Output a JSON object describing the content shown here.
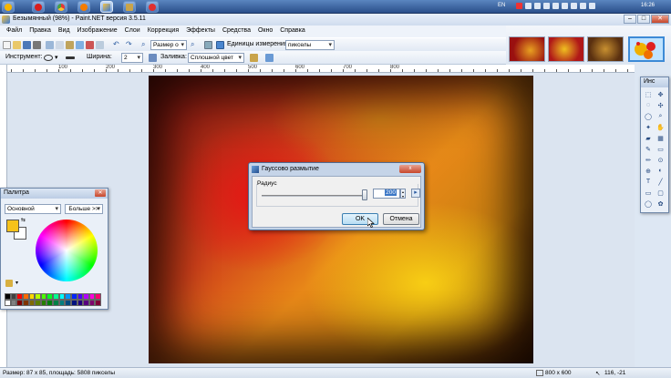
{
  "taskbar": {
    "language": "EN",
    "clock": "16:26"
  },
  "window": {
    "title": "Безымянный (98%) - Paint.NET версия 3.5.11"
  },
  "menu": [
    "Файл",
    "Правка",
    "Вид",
    "Изображение",
    "Слои",
    "Коррекция",
    "Эффекты",
    "Средства",
    "Окно",
    "Справка"
  ],
  "toolbar": {
    "zoom_label": "Размер о",
    "units_label": "Единицы измерения:",
    "units_value": "пикселы",
    "tool_label": "Инструмент:",
    "width_label": "Ширина:",
    "width_value": "2",
    "fill_label": "Заливка:",
    "fill_value": "Сплошной цвет"
  },
  "ruler": {
    "labels": [
      "100",
      "200",
      "300",
      "400",
      "500",
      "600",
      "700",
      "800"
    ]
  },
  "palette": {
    "title": "Палитра",
    "mode": "Основной",
    "more_button": "Больше >>",
    "primary_color": "#f6c21a",
    "secondary_color": "#ffffff",
    "swatches": [
      "#000000",
      "#404040",
      "#ff0000",
      "#ff6a00",
      "#ffd800",
      "#b6ff00",
      "#4cff00",
      "#00ff21",
      "#00ff90",
      "#00ffff",
      "#0094ff",
      "#0026ff",
      "#4800ff",
      "#b200ff",
      "#ff00dc",
      "#ff006e",
      "#ffffff",
      "#808080",
      "#7f0000",
      "#7f3300",
      "#7f6a00",
      "#5b7f00",
      "#267f00",
      "#007f0e",
      "#007f46",
      "#007f7f",
      "#004a7f",
      "#00137f",
      "#21007f",
      "#57007f",
      "#7f006e",
      "#7f0037"
    ]
  },
  "tools": {
    "title": "Инс",
    "icons": [
      "select-rect-icon",
      "move-icon",
      "lasso-icon",
      "move-selection-icon",
      "ellipse-select-icon",
      "zoom-icon",
      "magic-wand-icon",
      "pan-icon",
      "bucket-icon",
      "gradient-icon",
      "brush-icon",
      "eraser-icon",
      "pencil-icon",
      "color-picker-icon",
      "stamp-icon",
      "recolor-icon",
      "text-icon",
      "line-icon",
      "rectangle-icon",
      "rounded-rect-icon",
      "ellipse-icon",
      "freeform-icon"
    ]
  },
  "dialog": {
    "title": "Гауссово размытие",
    "group_label": "Радиус",
    "value": "200",
    "ok": "OK",
    "cancel": "Отмена",
    "close": "x"
  },
  "status": {
    "left": "Размер: 87 x 85, площадь: 5808 пикселы",
    "size": "800 x 600",
    "coords": "116, -21"
  },
  "colors": {
    "accent": "#3d78c6",
    "canvas_yellow": "#f6c21a",
    "canvas_red": "#e01818"
  }
}
